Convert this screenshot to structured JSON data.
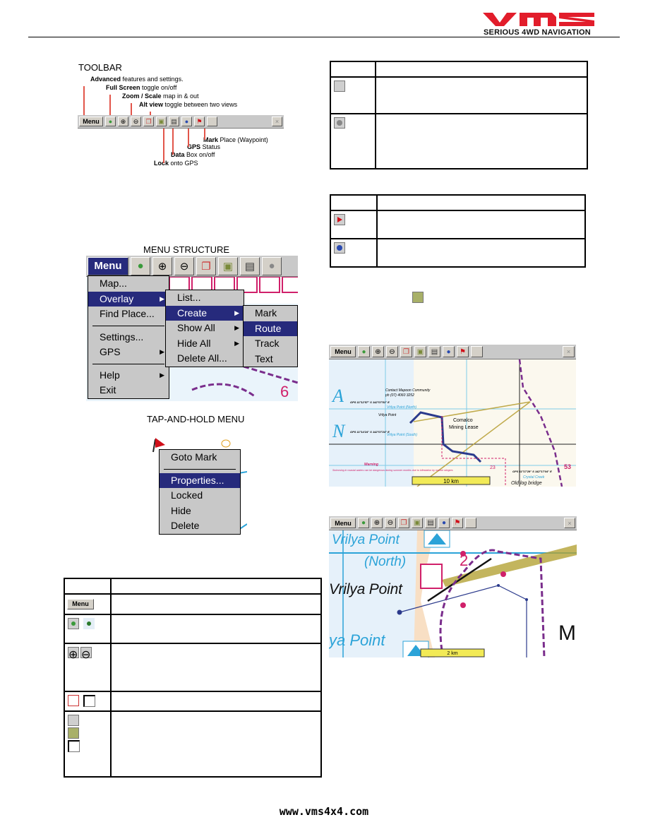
{
  "header": {
    "brand": "VMS",
    "tagline": "SERIOUS 4WD NAVIGATION",
    "brand_color": "#e21d2b"
  },
  "toolbar_section": {
    "title": "TOOLBAR",
    "annotations": [
      {
        "bold": "Advanced",
        "rest": " features and settings."
      },
      {
        "bold": "Full Screen",
        "rest": " toggle on/off"
      },
      {
        "bold": "Zoom / Scale",
        "rest": " map in & out"
      },
      {
        "bold": "Alt view",
        "rest": " toggle between two views"
      },
      {
        "bold": "Mark",
        "rest": " Place (Waypoint)"
      },
      {
        "bold": "GPS",
        "rest": " Status"
      },
      {
        "bold": "Data",
        "rest": " Box on/off"
      },
      {
        "bold": "Lock",
        "rest": " onto GPS"
      }
    ]
  },
  "toolbar": {
    "menu_label": "Menu",
    "buttons": [
      "full-screen-icon",
      "zoom-in-icon",
      "zoom-out-icon",
      "alt-view-icon",
      "lock-gps-icon",
      "data-box-icon",
      "gps-status-icon",
      "mark-flag-icon",
      "blank"
    ],
    "close": "×"
  },
  "menu_structure": {
    "title": "MENU STRUCTURE",
    "main": [
      {
        "label": "Map..."
      },
      {
        "label": "Overlay",
        "submenu": true,
        "selected": true
      },
      {
        "label": "Find Place..."
      },
      {
        "sep": true
      },
      {
        "label": "Settings..."
      },
      {
        "label": "GPS",
        "submenu": true
      },
      {
        "sep": true
      },
      {
        "label": "Help",
        "submenu": true
      },
      {
        "label": "Exit"
      }
    ],
    "overlay": [
      {
        "label": "List..."
      },
      {
        "label": "Create",
        "submenu": true,
        "selected": true
      },
      {
        "label": "Show All",
        "submenu": true
      },
      {
        "label": "Hide All",
        "submenu": true
      },
      {
        "label": "Delete All..."
      }
    ],
    "create": [
      {
        "label": "Mark"
      },
      {
        "label": "Route",
        "selected": true
      },
      {
        "label": "Track"
      },
      {
        "label": "Text"
      }
    ]
  },
  "tap_hold": {
    "title": "TAP-AND-HOLD MENU",
    "items": [
      {
        "label": "Goto Mark"
      },
      {
        "sep": true
      },
      {
        "label": "Properties...",
        "selected": true
      },
      {
        "label": "Locked"
      },
      {
        "label": "Hide"
      },
      {
        "label": "Delete"
      }
    ]
  },
  "map1": {
    "labels": [
      "Contact Mapoon Community",
      "ph (07) 4060 3252",
      "Vrilya Point (North)",
      "Vrilya Point",
      "Vrilya Point (South)",
      "Comalco",
      "Mining Lease",
      "Warning",
      "Swimming in coastal waters can be dangerous during summer months due to infestation by marine stingers",
      "Crystal Creek",
      "Old log bridge",
      "23",
      "53",
      "GPS 11°12'57\" S 142°07'51\" E",
      "GPS 11°14'24\" S 142°07'24\" E",
      "GPS 11°17'29\" S 142°17'04\" E"
    ],
    "scale": "10 km"
  },
  "map2": {
    "labels": [
      "Vrilya Point",
      "(North)",
      "Vrilya Point",
      "ya Point",
      "M"
    ],
    "scale": "2 km"
  },
  "footer": {
    "url": "www.vms4x4.com"
  },
  "colors": {
    "menu_highlight": "#262a7c",
    "toolbar_bg": "#c9c9c9",
    "scale_bar": "#f2ea56",
    "route": "#2b3a8c"
  }
}
